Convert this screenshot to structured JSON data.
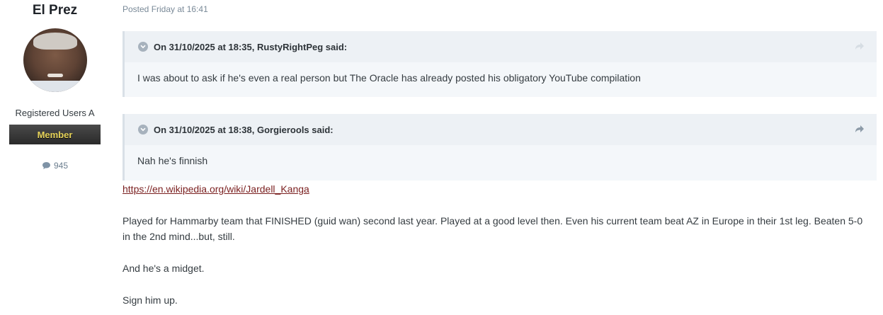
{
  "author": {
    "name": "El Prez",
    "group": "Registered Users A",
    "rank": "Member",
    "post_count": "945",
    "post_count_icon": "speech-bubble-icon"
  },
  "post": {
    "meta": "Posted Friday at 16:41",
    "quotes": [
      {
        "cite": "On 31/10/2025 at 18:35, RustyRightPeg said:",
        "body": "I was about to ask if he's even a real person but The Oracle has already posted his obligatory YouTube compilation"
      },
      {
        "cite": "On 31/10/2025 at 18:38, Gorgierools said:",
        "body": "Nah he's finnish"
      }
    ],
    "link": "https://en.wikipedia.org/wiki/Jardell_Kanga",
    "paragraphs": [
      "Played for Hammarby team that FINISHED (guid wan) second last year. Played at a good level then. Even his current team beat AZ in Europe in their 1st leg. Beaten 5-0 in the 2nd mind...but, still.",
      "And he's a midget.",
      "Sign him up."
    ]
  },
  "colors": {
    "rank_badge_text": "#e6d35a",
    "link": "#7a1f1f",
    "quote_background": "#f4f7fa"
  }
}
